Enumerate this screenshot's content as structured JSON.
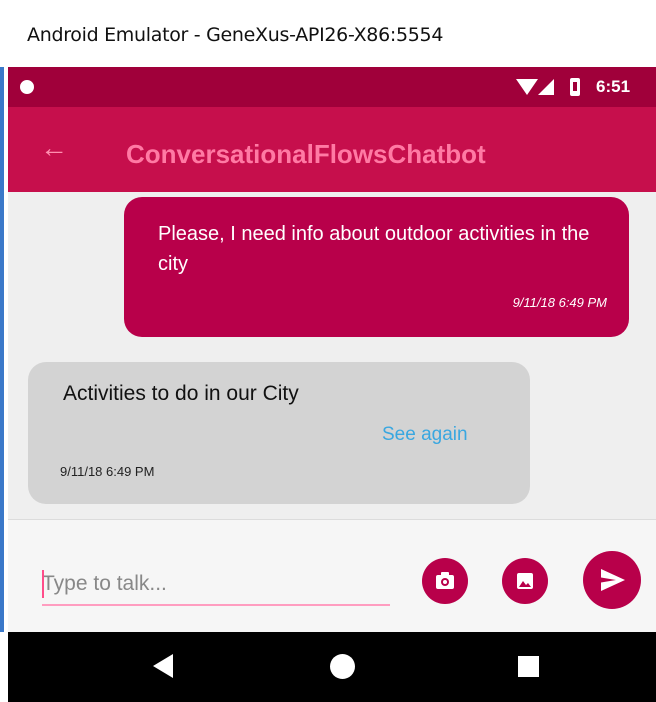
{
  "window": {
    "title": "Android Emulator - GeneXus-API26-X86:5554"
  },
  "status_bar": {
    "time": "6:51"
  },
  "toolbar": {
    "back_icon": "arrow-left-icon",
    "title": "ConversationalFlowsChatbot"
  },
  "messages": [
    {
      "direction": "outgoing",
      "text": "Please, I need info about outdoor activities in the city",
      "timestamp": "9/11/18 6:49 PM"
    },
    {
      "direction": "incoming",
      "text": "Activities to do in our City",
      "link": "See again",
      "timestamp": "9/11/18 6:49 PM"
    }
  ],
  "composer": {
    "placeholder": "Type to talk..."
  },
  "colors": {
    "status_bar": "#a0003a",
    "toolbar": "#c60f4c",
    "accent": "#b8004a",
    "link": "#3aa7e0"
  }
}
